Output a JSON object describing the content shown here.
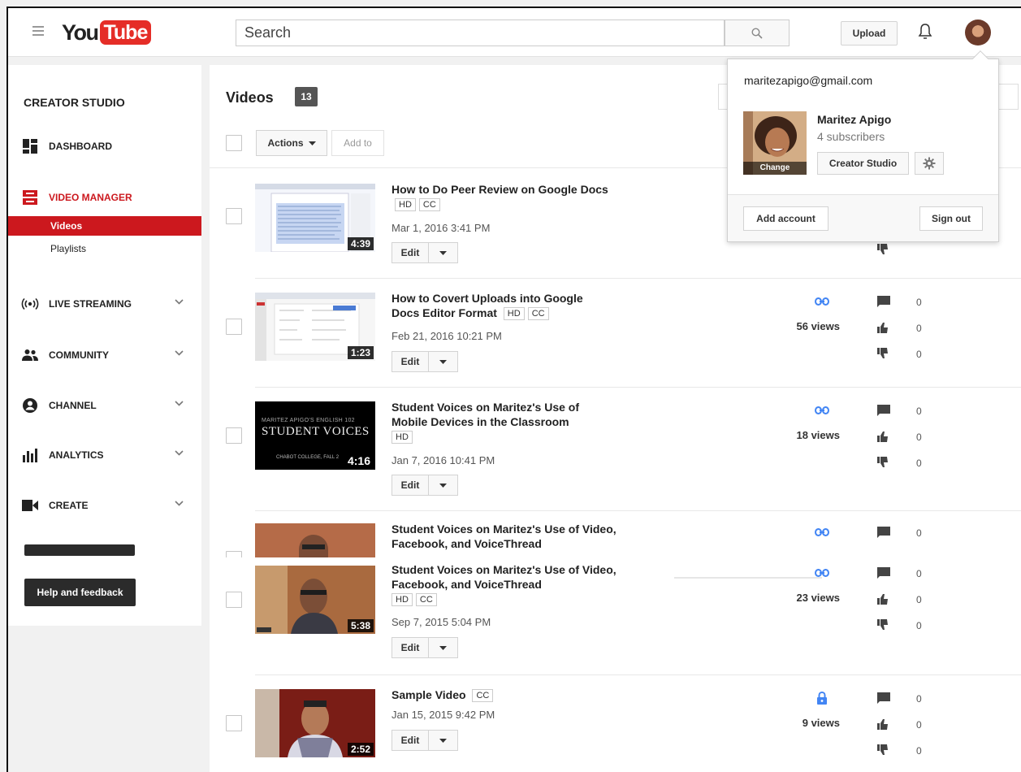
{
  "header": {
    "logo_you": "You",
    "logo_tube": "Tube",
    "search_placeholder": "Search",
    "upload_label": "Upload"
  },
  "sidebar": {
    "title": "CREATOR STUDIO",
    "items": [
      {
        "label": "DASHBOARD",
        "icon": "dashboard-icon"
      },
      {
        "label": "VIDEO MANAGER",
        "icon": "video-manager-icon"
      },
      {
        "label": "LIVE STREAMING",
        "icon": "live-streaming-icon"
      },
      {
        "label": "COMMUNITY",
        "icon": "community-icon"
      },
      {
        "label": "CHANNEL",
        "icon": "channel-icon"
      },
      {
        "label": "ANALYTICS",
        "icon": "analytics-icon"
      },
      {
        "label": "CREATE",
        "icon": "create-icon"
      }
    ],
    "subitems": [
      {
        "label": "Videos",
        "active": true
      },
      {
        "label": "Playlists",
        "active": false
      }
    ],
    "help_label": "Help and feedback"
  },
  "main": {
    "title": "Videos",
    "count": "13",
    "actions_label": "Actions",
    "addto_label": "Add to",
    "edit_label": "Edit",
    "videos": [
      {
        "title": "How to Do Peer Review on Google Docs",
        "tags": [
          "HD",
          "CC"
        ],
        "date": "Mar 1, 2016 3:41 PM",
        "duration": "4:39"
      },
      {
        "title": "How to Covert Uploads into Google Docs Editor Format",
        "tags": [
          "HD",
          "CC"
        ],
        "date": "Feb 21, 2016 10:21 PM",
        "duration": "1:23",
        "views": "56 views",
        "comments": "0",
        "likes": "0",
        "dislikes": "0"
      },
      {
        "title": "Student Voices on Maritez's Use of Mobile Devices in the Classroom",
        "tags": [
          "HD"
        ],
        "date": "Jan 7, 2016 10:41 PM",
        "duration": "4:16",
        "thumb_text": "STUDENT VOICES",
        "thumb_top": "MARITEZ APIGO'S ENGLISH 102",
        "thumb_bottom": "CHABOT COLLEGE, FALL 2",
        "views": "18 views",
        "comments": "0",
        "likes": "0",
        "dislikes": "0"
      },
      {
        "title": "Student Voices on Maritez's Use of Video, Facebook, and VoiceThread",
        "tags": [
          "HD",
          "CC"
        ],
        "date": "Sep 7, 2015 5:04 PM",
        "duration": "5:38",
        "views": "23 views",
        "comments_ghost": "0",
        "comments": "0",
        "likes": "0",
        "dislikes": "0"
      },
      {
        "title": "Sample Video",
        "tags": [
          "CC"
        ],
        "date": "Jan 15, 2015 9:42 PM",
        "duration": "2:52",
        "views": "9 views",
        "comments": "0",
        "likes": "0",
        "dislikes": "0"
      }
    ]
  },
  "account_popup": {
    "email": "maritezapigo@gmail.com",
    "name": "Maritez Apigo",
    "subscribers": "4 subscribers",
    "change_label": "Change",
    "creator_studio_label": "Creator Studio",
    "add_account_label": "Add account",
    "sign_out_label": "Sign out"
  },
  "colors": {
    "brand_red": "#cc181e",
    "link_blue": "#4285f4"
  }
}
